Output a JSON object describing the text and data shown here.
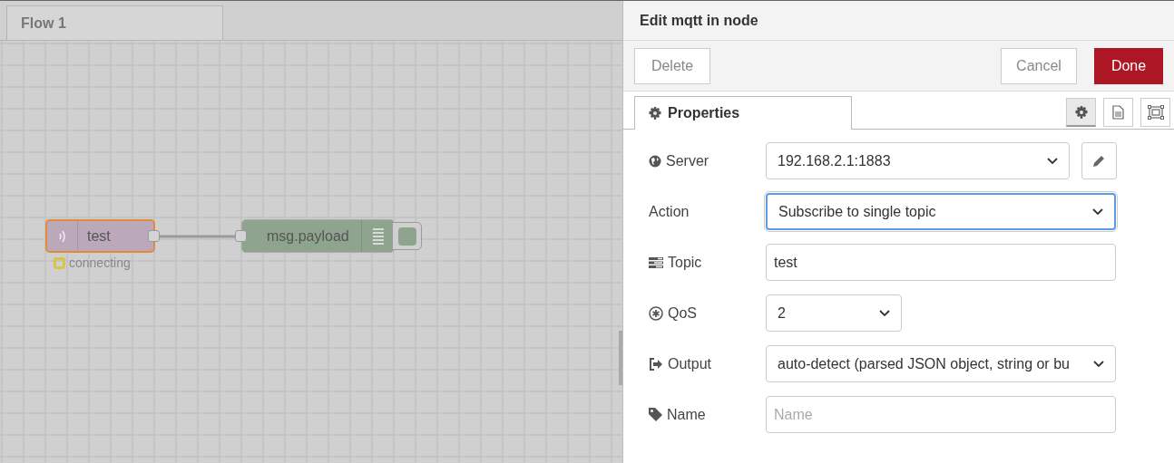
{
  "workspace": {
    "tabs": [
      {
        "label": "Flow 1",
        "selected": true
      }
    ],
    "nodes": [
      {
        "kind": "input",
        "label": "test",
        "selected": true,
        "status": "connecting",
        "color": "#d9c44a"
      },
      {
        "kind": "debug",
        "label": "msg.payload",
        "selected": false
      }
    ]
  },
  "tray": {
    "title": "Edit mqtt in node",
    "buttons": [
      {
        "label": "Delete",
        "kind": "plain"
      },
      {
        "label": "Cancel",
        "kind": "plain"
      },
      {
        "label": "Done",
        "kind": "primary"
      }
    ],
    "tabs": [
      {
        "label": "Properties",
        "selected": true
      }
    ],
    "tab_icons": [
      {
        "kind": "gear",
        "selected": true
      },
      {
        "kind": "document",
        "selected": false
      },
      {
        "kind": "frame",
        "selected": false
      }
    ],
    "fields": [
      {
        "label": "Server",
        "kind": "select_edit",
        "value": "192.168.2.1:1883",
        "focused": false
      },
      {
        "label": "Action",
        "kind": "select",
        "value": "Subscribe to single topic",
        "focused": true
      },
      {
        "label": "Topic",
        "kind": "input",
        "value": "test",
        "focused": false
      },
      {
        "label": "QoS",
        "kind": "select_small",
        "value": "2",
        "focused": false
      },
      {
        "label": "Output",
        "kind": "select",
        "value": "auto-detect (parsed JSON object, string or bu",
        "focused": false
      },
      {
        "label": "Name",
        "kind": "input",
        "placeholder": "Name",
        "focused": false
      }
    ]
  }
}
